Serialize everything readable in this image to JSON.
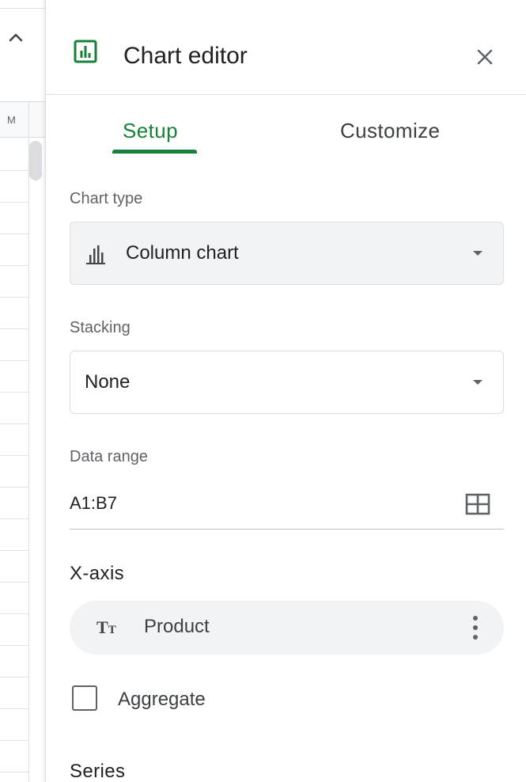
{
  "sheet": {
    "collapse_icon": "chevron-up-icon",
    "column_header": "M"
  },
  "editor": {
    "title": "Chart editor",
    "tabs": [
      {
        "label": "Setup",
        "active": true
      },
      {
        "label": "Customize",
        "active": false
      }
    ],
    "chart_type": {
      "label": "Chart type",
      "value": "Column chart",
      "icon": "column-chart-icon"
    },
    "stacking": {
      "label": "Stacking",
      "value": "None"
    },
    "data_range": {
      "label": "Data range",
      "value": "A1:B7",
      "icon": "grid-select-icon"
    },
    "x_axis": {
      "heading": "X-axis",
      "chip": {
        "icon_text": "T",
        "icon_text_small": "T",
        "label": "Product"
      }
    },
    "aggregate": {
      "label": "Aggregate",
      "checked": false
    },
    "series": {
      "heading": "Series"
    }
  },
  "colors": {
    "accent": "#188038",
    "chip_bg": "#f1f3f4",
    "text": "#202124",
    "muted": "#5f6368"
  }
}
